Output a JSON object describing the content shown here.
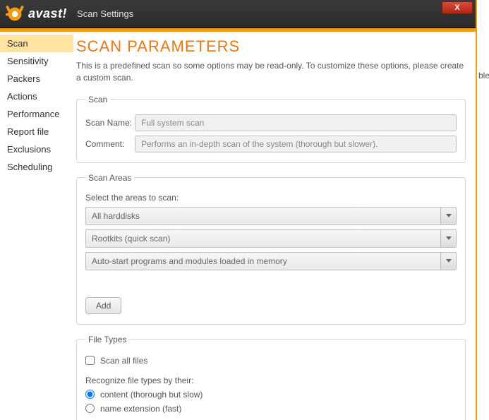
{
  "behind_text": "ble",
  "titlebar": {
    "logo_text": "avast!",
    "title": "Scan Settings",
    "close_glyph": "X"
  },
  "sidebar": {
    "items": [
      {
        "label": "Scan",
        "active": true
      },
      {
        "label": "Sensitivity",
        "active": false
      },
      {
        "label": "Packers",
        "active": false
      },
      {
        "label": "Actions",
        "active": false
      },
      {
        "label": "Performance",
        "active": false
      },
      {
        "label": "Report file",
        "active": false
      },
      {
        "label": "Exclusions",
        "active": false
      },
      {
        "label": "Scheduling",
        "active": false
      }
    ]
  },
  "page": {
    "title": "SCAN PARAMETERS",
    "subtitle": "This is a predefined scan so some options may be read-only. To customize these options, please create a custom scan."
  },
  "scan_group": {
    "legend": "Scan",
    "name_label": "Scan Name:",
    "name_value": "Full system scan",
    "comment_label": "Comment:",
    "comment_value": "Performs an in-depth scan of the system (thorough but slower)."
  },
  "areas_group": {
    "legend": "Scan Areas",
    "instruction": "Select the areas to scan:",
    "combos": [
      "All harddisks",
      "Rootkits (quick scan)",
      "Auto-start programs and modules loaded in memory"
    ],
    "add_label": "Add"
  },
  "filetypes_group": {
    "legend": "File Types",
    "scan_all_label": "Scan all files",
    "scan_all_checked": false,
    "recognize_label": "Recognize file types by their:",
    "radio_content": "content (thorough but slow)",
    "radio_name": "name extension (fast)",
    "radio_selected": "content"
  }
}
